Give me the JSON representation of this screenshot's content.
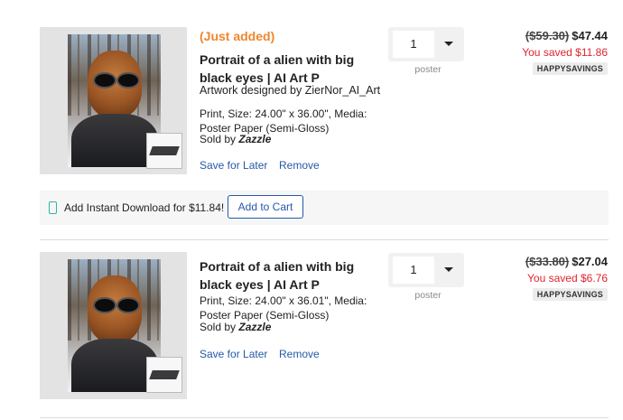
{
  "items": [
    {
      "just_added": "(Just added)",
      "title": "Portrait of a alien with big black eyes | AI Art P",
      "designer": "Artwork designed by ZierNor_AI_Art",
      "specs": "Print, Size: 24.00\" x 36.00\", Media: Poster Paper (Semi-Gloss)",
      "sold_by_prefix": "Sold by",
      "sold_by_brand": "Zazzle",
      "save_for_later": "Save for Later",
      "remove": "Remove",
      "quantity": "1",
      "quantity_label": "poster",
      "old_price": "($59.30)",
      "price": "$47.44",
      "saved": "You saved $11.86",
      "coupon": "HAPPYSAVINGS"
    },
    {
      "title": "Portrait of a alien with big black eyes | AI Art P",
      "specs": "Print, Size: 24.00\" x 36.01\", Media: Poster Paper (Semi-Gloss)",
      "sold_by_prefix": "Sold by",
      "sold_by_brand": "Zazzle",
      "save_for_later": "Save for Later",
      "remove": "Remove",
      "quantity": "1",
      "quantity_label": "poster",
      "old_price": "($33.80)",
      "price": "$27.04",
      "saved": "You saved $6.76",
      "coupon": "HAPPYSAVINGS"
    }
  ],
  "download_offer": {
    "icon": "phone-icon",
    "text": "Add Instant Download for $11.84!",
    "button": "Add to Cart"
  },
  "colors": {
    "accent_blue": "#2559a8",
    "just_added_orange": "#f0862c",
    "saved_red": "#e0242e",
    "download_icon_teal": "#2bb8a3"
  }
}
